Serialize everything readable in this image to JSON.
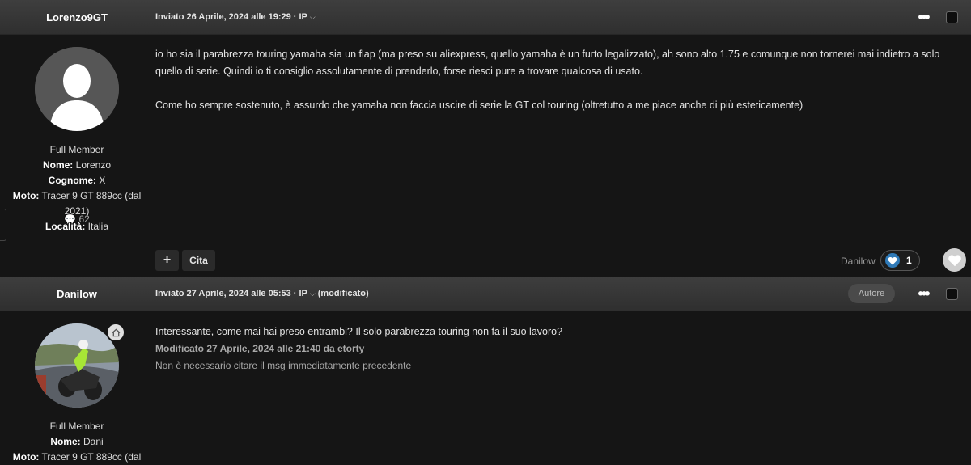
{
  "posts": [
    {
      "author": "Lorenzo9GT",
      "posted": "Inviato 26 Aprile, 2024 alle 19:29",
      "ip_label": "· IP",
      "more_icon": "ellipsis-icon",
      "member_group": "Full Member",
      "fields": [
        {
          "label": "Nome:",
          "value": " Lorenzo"
        },
        {
          "label": "Cognome:",
          "value": " X"
        },
        {
          "label": "Moto:",
          "value": " Tracer 9 GT 889cc (dal 2021)"
        },
        {
          "label": "Località:",
          "value": " Italia"
        }
      ],
      "post_count": "62",
      "body": [
        "io ho sia il parabrezza touring yamaha sia un flap (ma preso su aliexpress, quello yamaha è un furto legalizzato), ah sono alto 1.75 e comunque non tornerei mai indietro a solo quello di serie. Quindi io ti consiglio assolutamente di prenderlo, forse riesci pure a trovare qualcosa di usato.",
        "Come ho sempre sostenuto, è assurdo che yamaha non faccia uscire di serie la GT col touring (oltretutto a me piace anche di più esteticamente)"
      ],
      "multiquote_label": "+",
      "quote_label": "Cita",
      "reaction_user": "Danilow",
      "reaction_count": "1"
    },
    {
      "author": "Danilow",
      "posted": "Inviato 27 Aprile, 2024 alle 05:53",
      "ip_label": "· IP",
      "modified_label": "(modificato)",
      "badge": "Autore",
      "member_group": "Full Member",
      "fields": [
        {
          "label": "Nome:",
          "value": " Dani"
        },
        {
          "label": "Moto:",
          "value": " Tracer 9 GT 889cc (dal"
        }
      ],
      "body": [
        "Interessante, come mai hai preso entrambi? Il solo parabrezza touring non fa il suo lavoro?"
      ],
      "edited": "Modificato 27 Aprile, 2024 alle 21:40 da etorty",
      "edit_reason": "Non è necessario citare il msg immediatamente precedente"
    }
  ],
  "colors": {
    "background": "#151515",
    "header_bar": "#3a3a3a",
    "reaction_blue": "#2f7ab8"
  }
}
